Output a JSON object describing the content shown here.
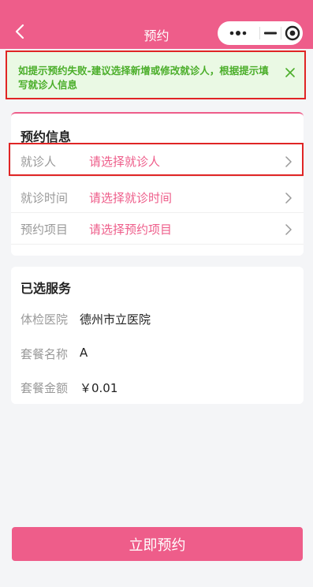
{
  "nav": {
    "title": "预约",
    "back_icon": "chevron-left-icon",
    "capsule": {
      "more_icon": "more-dots-icon",
      "minimize_icon": "minimize-icon",
      "close_icon": "target-close-icon"
    },
    "bg_color": "#ee5d8a"
  },
  "notice": {
    "text": "如提示预约失败-建议选择新增或修改就诊人，根据提示填写就诊人信息",
    "close_icon": "close-icon",
    "color": "#4bae2a"
  },
  "booking": {
    "title": "预约信息",
    "rows": [
      {
        "label": "就诊人",
        "value": "请选择就诊人"
      },
      {
        "label": "就诊时间",
        "value": "请选择就诊时间"
      },
      {
        "label": "预约项目",
        "value": "请选择预约项目"
      }
    ]
  },
  "service": {
    "title": "已选服务",
    "rows": [
      {
        "label": "体检医院",
        "value": "德州市立医院"
      },
      {
        "label": "套餐名称",
        "value": "A"
      },
      {
        "label": "套餐金额",
        "value": "￥0.01"
      }
    ]
  },
  "submit": {
    "label": "立即预约"
  },
  "colors": {
    "accent": "#ee5d8a",
    "highlight_border": "#e02525"
  }
}
